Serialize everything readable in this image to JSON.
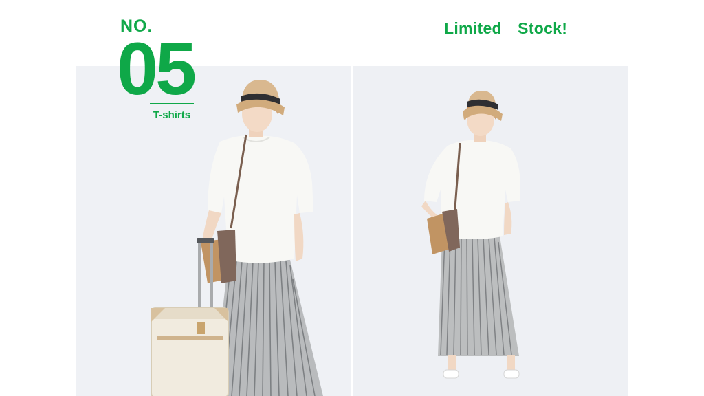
{
  "header": {
    "no_label": "NO.",
    "number": "05",
    "category": "T-shirts",
    "tagline": "Limited　Stock!"
  },
  "colors": {
    "accent": "#0fa848",
    "photo_background": "#eff1f5"
  },
  "photos": [
    {
      "name": "model-with-suitcase"
    },
    {
      "name": "model-standing-front"
    }
  ]
}
